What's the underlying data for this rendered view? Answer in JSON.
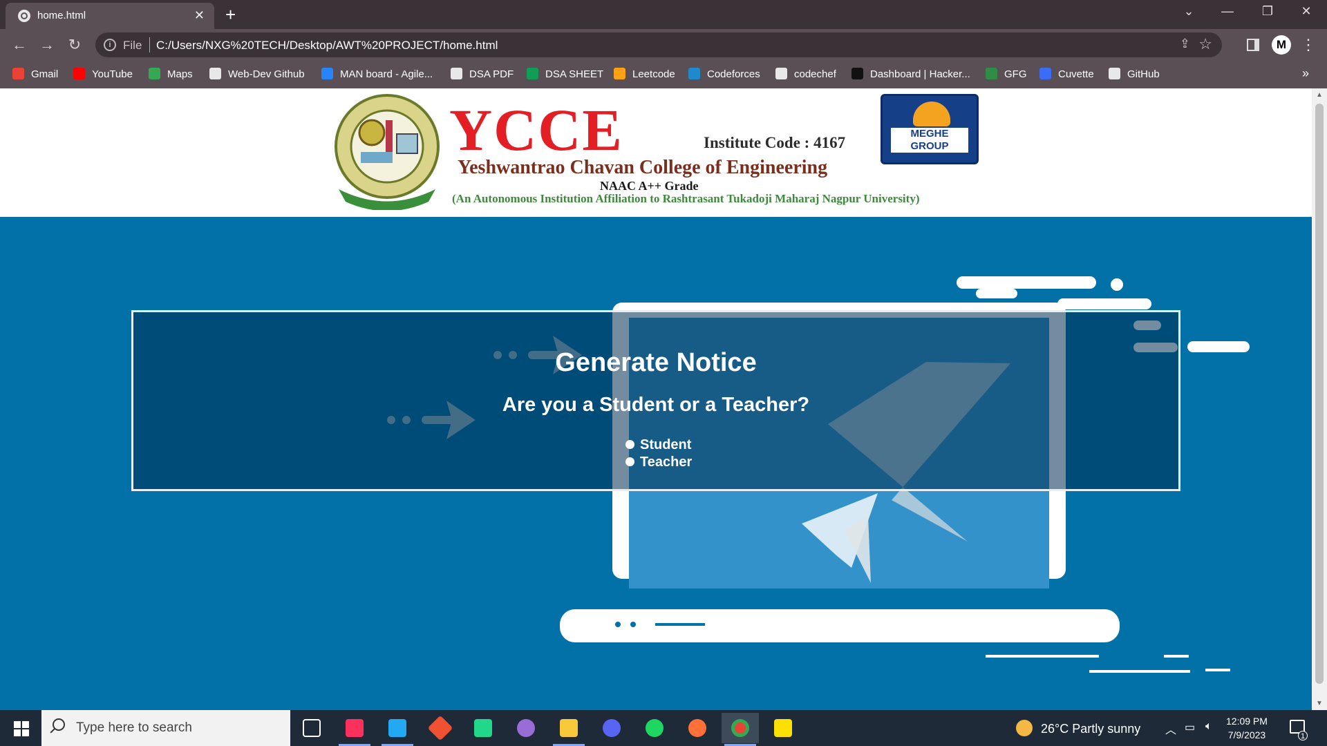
{
  "browser": {
    "tab_title": "home.html",
    "new_tab": "+",
    "address_scheme": "File",
    "address_url": "C:/Users/NXG%20TECH/Desktop/AWT%20PROJECT/home.html",
    "profile_initial": "M",
    "bookmarks": [
      {
        "label": "Gmail",
        "icon": "gmail-icon",
        "color": "#ea4335"
      },
      {
        "label": "YouTube",
        "icon": "youtube-icon",
        "color": "#ff0000"
      },
      {
        "label": "Maps",
        "icon": "maps-icon",
        "color": "#34a853"
      },
      {
        "label": "Web-Dev Github",
        "icon": "github-icon",
        "color": "#e8e8e8"
      },
      {
        "label": "MAN board - Agile...",
        "icon": "jira-icon",
        "color": "#2684ff"
      },
      {
        "label": "DSA PDF",
        "icon": "globe-icon",
        "color": "#e8e8e8"
      },
      {
        "label": "DSA SHEET",
        "icon": "sheets-icon",
        "color": "#0f9d58"
      },
      {
        "label": "Leetcode",
        "icon": "leetcode-icon",
        "color": "#ffa116"
      },
      {
        "label": "Codeforces",
        "icon": "codeforces-icon",
        "color": "#1f8acb"
      },
      {
        "label": "codechef",
        "icon": "codechef-icon",
        "color": "#e8e8e8"
      },
      {
        "label": "Dashboard | Hacker...",
        "icon": "hackerrank-icon",
        "color": "#111111"
      },
      {
        "label": "GFG",
        "icon": "gfg-icon",
        "color": "#2f8d46"
      },
      {
        "label": "Cuvette",
        "icon": "cuvette-icon",
        "color": "#3b6cf6"
      },
      {
        "label": "GitHub",
        "icon": "github-icon",
        "color": "#e8e8e8"
      }
    ],
    "bookmarks_more": "»"
  },
  "header": {
    "logo_text": "YCCE",
    "institute_code": "Institute Code : 4167",
    "college_name": "Yeshwantrao Chavan College of Engineering",
    "naac": "NAAC A++ Grade",
    "affiliation": "(An Autonomous Institution Affiliation to Rashtrasant Tukadoji Maharaj Nagpur University)",
    "meghe_logo_text": "MEGHE GROUP"
  },
  "notice": {
    "title": "Generate Notice",
    "question": "Are you a Student or a Teacher?",
    "options": [
      "Student",
      "Teacher"
    ]
  },
  "taskbar": {
    "search_placeholder": "Type here to search",
    "apps": [
      {
        "name": "task-view",
        "color": "#ffffff"
      },
      {
        "name": "intellij",
        "color": "#fe315d"
      },
      {
        "name": "vscode",
        "color": "#23a9f2"
      },
      {
        "name": "git-gui",
        "color": "#f05133"
      },
      {
        "name": "pycharm",
        "color": "#21d789"
      },
      {
        "name": "github-desktop",
        "color": "#9a6cd6"
      },
      {
        "name": "file-explorer",
        "color": "#f8c93a"
      },
      {
        "name": "discord",
        "color": "#5865f2"
      },
      {
        "name": "spotify",
        "color": "#1ed760"
      },
      {
        "name": "firefox",
        "color": "#ff7139"
      },
      {
        "name": "chrome",
        "color": "#ea4335"
      },
      {
        "name": "sticky-notes",
        "color": "#fce100"
      }
    ],
    "weather": "26°C  Partly sunny",
    "time": "12:09 PM",
    "date": "7/9/2023",
    "notification_count": "1"
  }
}
